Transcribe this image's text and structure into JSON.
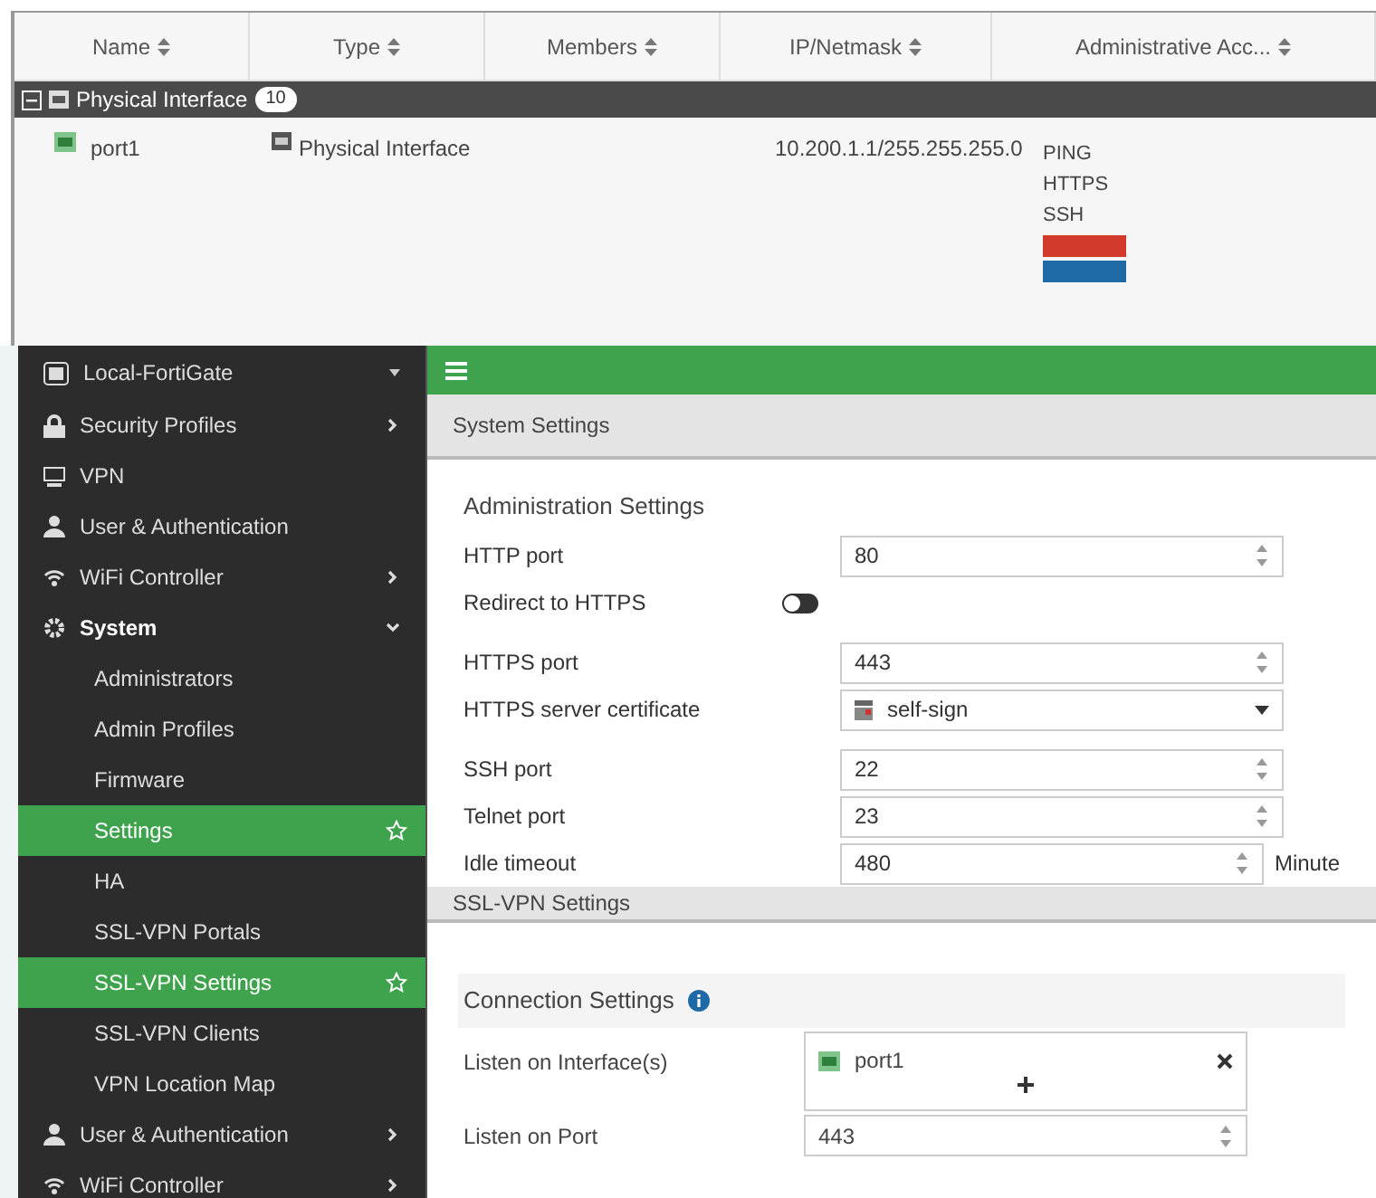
{
  "interface_table": {
    "columns": [
      "Name",
      "Type",
      "Members",
      "IP/Netmask",
      "Administrative Acc..."
    ],
    "group": {
      "label": "Physical Interface",
      "count": "10",
      "expanded": true
    },
    "rows": [
      {
        "name": "port1",
        "type": "Physical Interface",
        "ip": "10.200.1.1/255.255.255.0",
        "access": [
          "PING",
          "HTTPS",
          "SSH"
        ],
        "access_badges": [
          {
            "color": "#d23b2c"
          },
          {
            "color": "#1f6aa6"
          }
        ]
      }
    ]
  },
  "sidebar": {
    "header": "Local-FortiGate",
    "items": [
      {
        "label": "Security Profiles",
        "kind": "section",
        "expanded": false
      },
      {
        "label": "VPN",
        "kind": "section"
      },
      {
        "label": "User & Authentication",
        "kind": "section"
      },
      {
        "label": "WiFi Controller",
        "kind": "section",
        "expanded": false
      },
      {
        "label": "System",
        "kind": "section",
        "expanded": true
      },
      {
        "label": "Administrators",
        "kind": "sub",
        "selected": false
      },
      {
        "label": "Admin Profiles",
        "kind": "sub",
        "selected": false
      },
      {
        "label": "Firmware",
        "kind": "sub",
        "selected": false
      },
      {
        "label": "Settings",
        "kind": "sub",
        "selected": true
      },
      {
        "label": "HA",
        "kind": "sub",
        "selected": false
      },
      {
        "label": "SSL-VPN Portals",
        "kind": "sub",
        "selected": false
      },
      {
        "label": "SSL-VPN Settings",
        "kind": "sub",
        "selected": true
      },
      {
        "label": "SSL-VPN Clients",
        "kind": "sub",
        "selected": false
      },
      {
        "label": "VPN Location Map",
        "kind": "sub",
        "selected": false
      },
      {
        "label": "User & Authentication",
        "kind": "section",
        "expanded": false
      },
      {
        "label": "WiFi Controller",
        "kind": "section",
        "expanded": false
      }
    ]
  },
  "system_settings": {
    "title": "System Settings",
    "section": "Administration Settings",
    "fields": [
      {
        "label": "HTTP port",
        "kind": "number",
        "value": "80"
      },
      {
        "label": "Redirect to HTTPS",
        "kind": "toggle",
        "on": false
      },
      {
        "label": "HTTPS port",
        "kind": "number",
        "value": "443"
      },
      {
        "label": "HTTPS server certificate",
        "kind": "select",
        "value": "self-sign"
      },
      {
        "label": "SSH port",
        "kind": "number",
        "value": "22"
      },
      {
        "label": "Telnet port",
        "kind": "number",
        "value": "23"
      },
      {
        "label": "Idle timeout",
        "kind": "number",
        "value": "480",
        "unit": "Minute"
      }
    ]
  },
  "ssl_vpn_settings": {
    "title": "SSL-VPN Settings",
    "section": "Connection Settings",
    "listen_interface_label": "Listen on Interface(s)",
    "interfaces": [
      "port1"
    ],
    "listen_port_label": "Listen on Port",
    "listen_port": "443"
  }
}
